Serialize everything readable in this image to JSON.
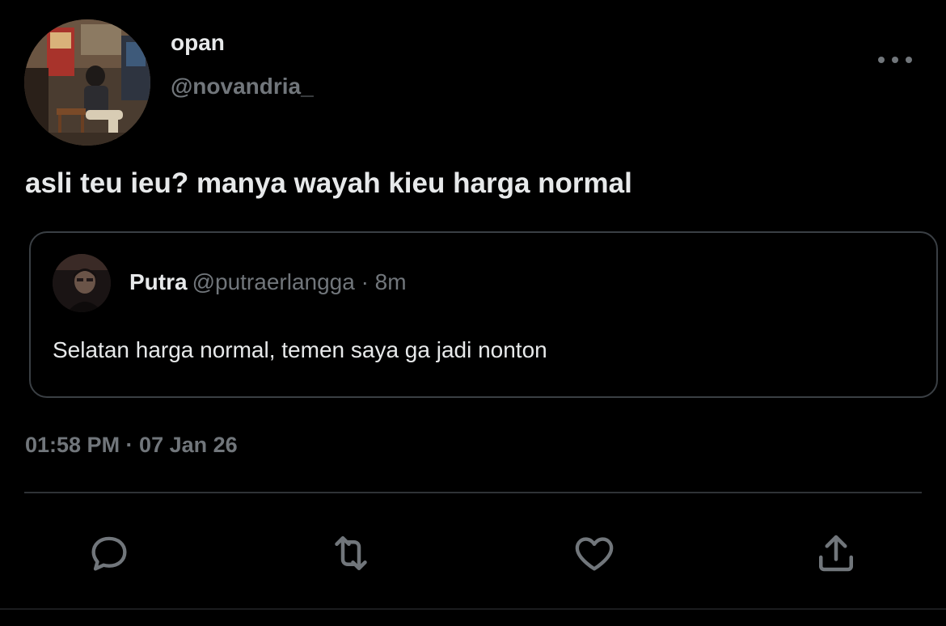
{
  "tweet": {
    "author": {
      "display_name": "opan",
      "handle": "@novandria_"
    },
    "text": "asli teu ieu? manya wayah kieu harga normal",
    "timestamp": "01:58 PM · 07 Jan 26"
  },
  "quoted_tweet": {
    "display_name": "Putra",
    "meta": "@putraerlangga · 8m",
    "text": "Selatan harga normal, temen saya ga jadi nonton"
  },
  "actions": [
    {
      "icon": "reply-icon"
    },
    {
      "icon": "retweet-icon"
    },
    {
      "icon": "like-icon"
    },
    {
      "icon": "share-icon"
    }
  ],
  "colors": {
    "background": "#000000",
    "primary_text": "#e7e9ea",
    "secondary_text": "#71767b",
    "border": "#3a3f44",
    "icon": "#71767b"
  }
}
